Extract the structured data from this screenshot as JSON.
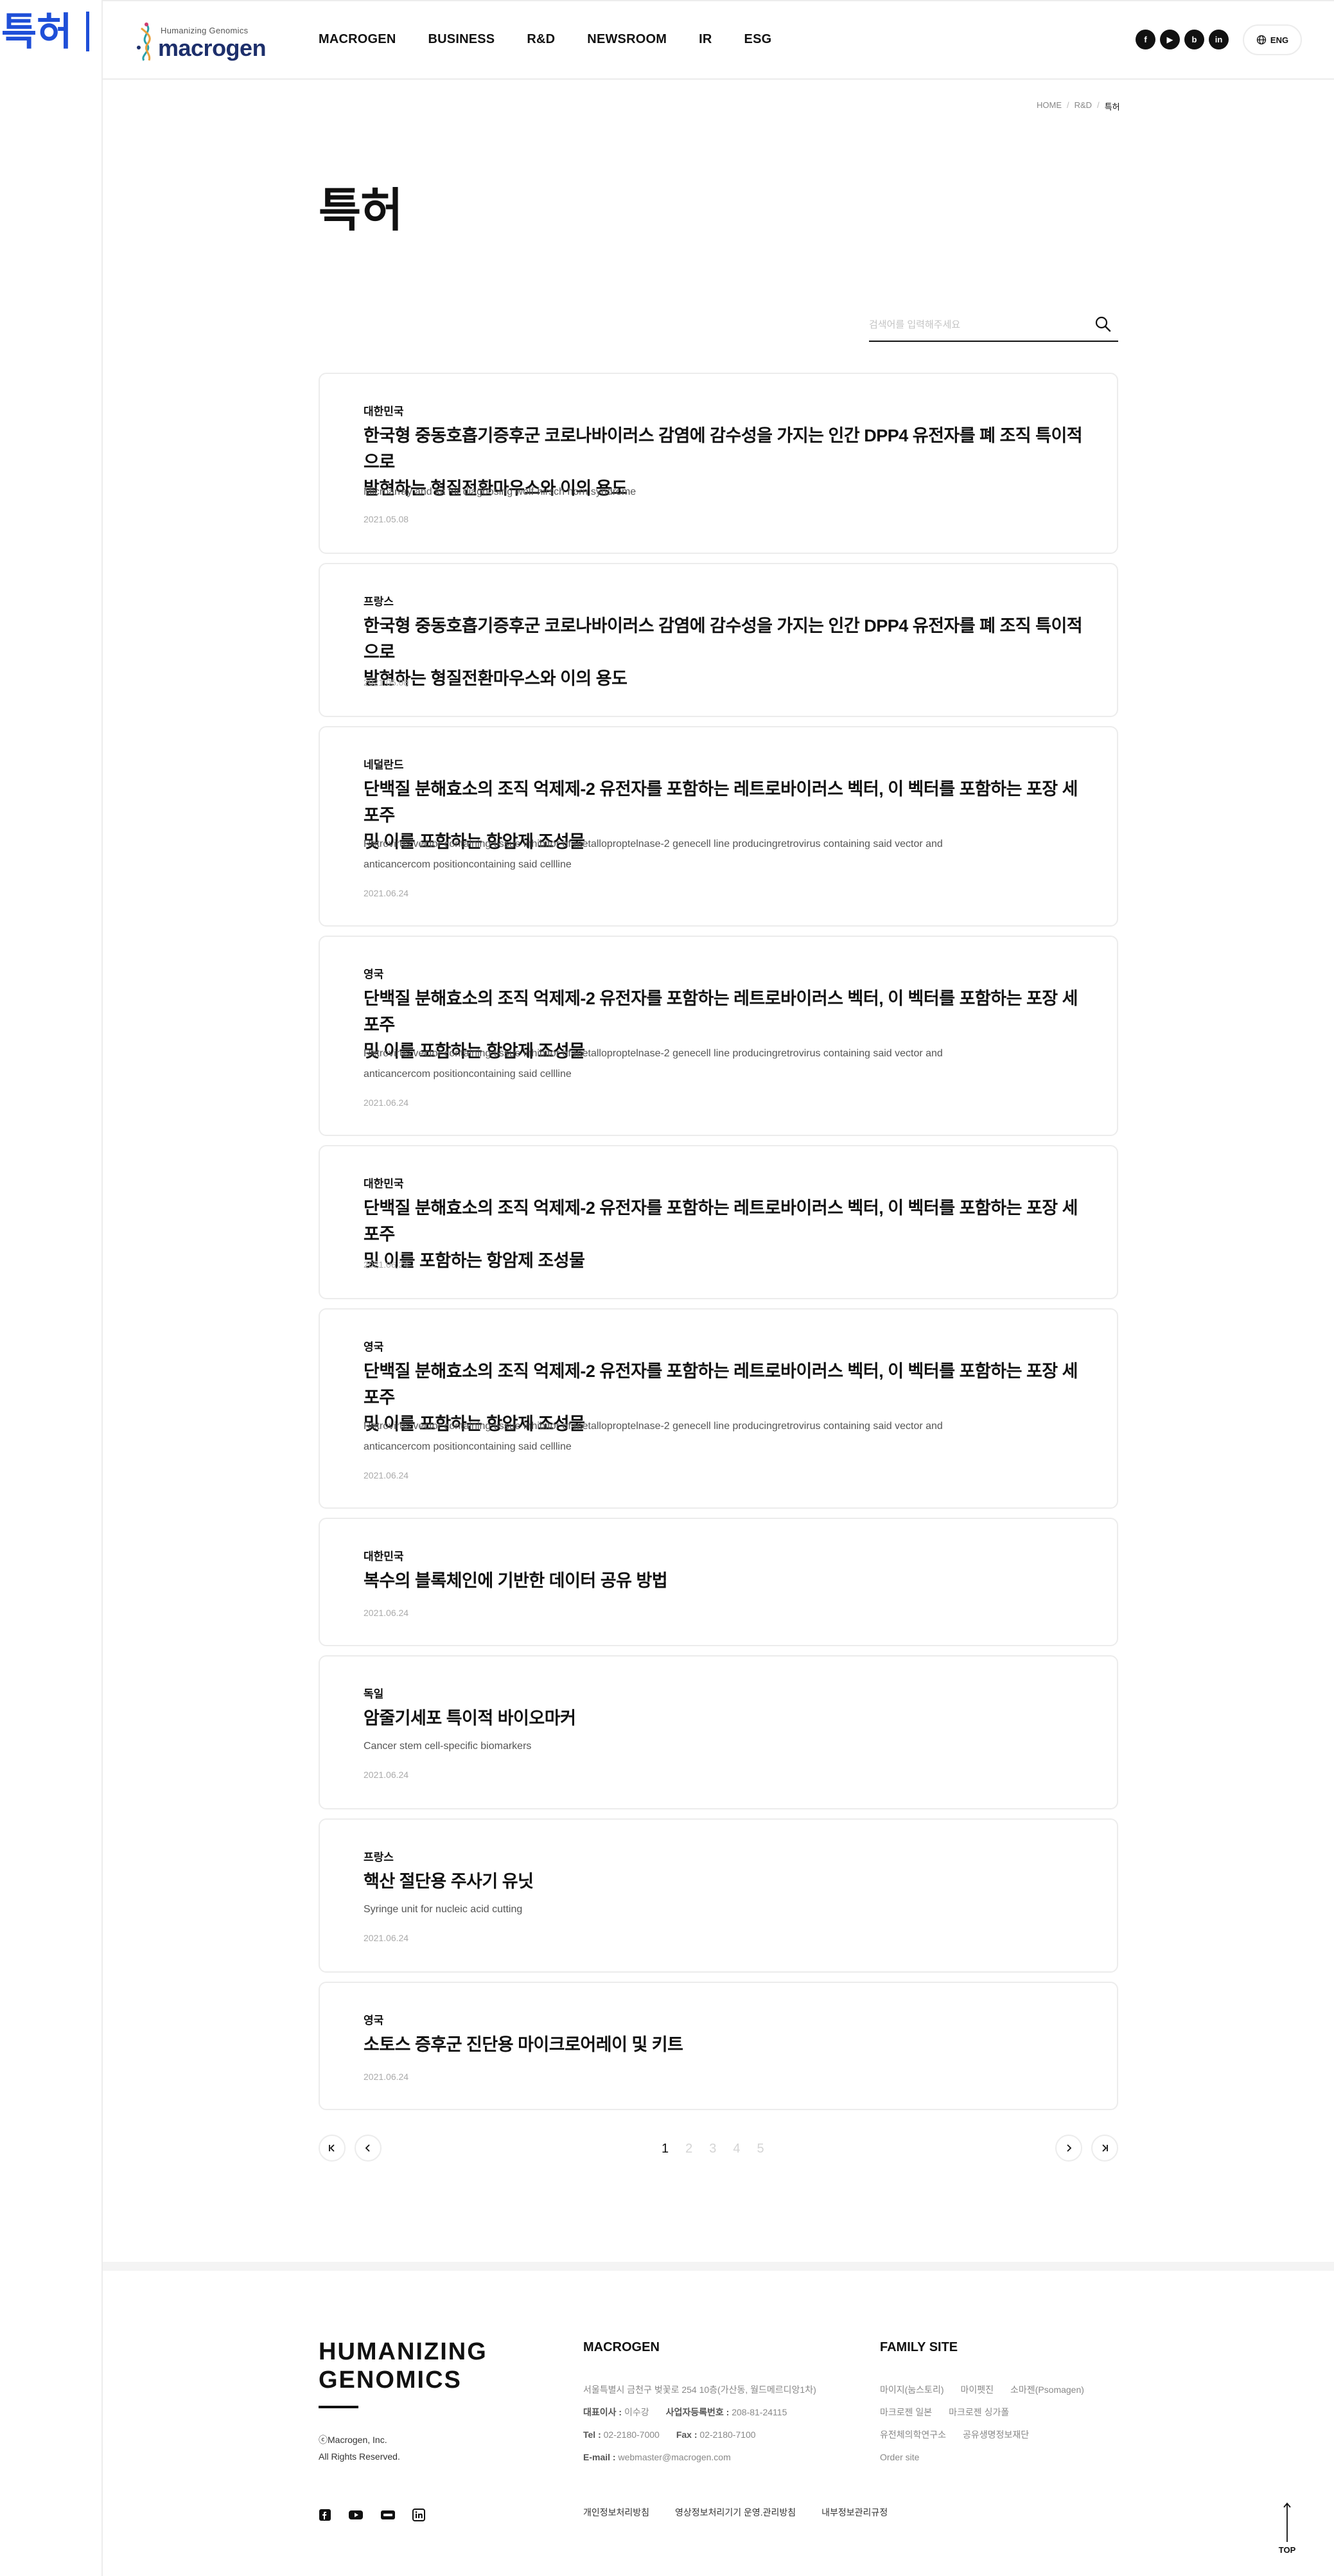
{
  "annotation": {
    "title": "특허"
  },
  "header": {
    "logo": {
      "tagline": "Humanizing Genomics",
      "wordmark": "macrogen"
    },
    "nav": [
      "MACROGEN",
      "BUSINESS",
      "R&D",
      "NEWSROOM",
      "IR",
      "ESG"
    ],
    "social": [
      "f",
      "▶",
      "b",
      "in"
    ],
    "lang": "ENG"
  },
  "breadcrumb": [
    "HOME",
    "R&D",
    "특허"
  ],
  "page_title": "특허",
  "search": {
    "placeholder": "검색어를 입력해주세요",
    "value": ""
  },
  "patents": [
    {
      "country": "대한민국",
      "title_lines": [
        "한국형 중동호흡기증후군 코로나바이러스 감염에 감수성을 가지는 인간 DPP4 유전자를 폐 조직 특이적으로",
        "발현하는 형질전환마우스와 이의 용도"
      ],
      "desc_lines": [
        "Microarray and kit for diagbosing wolf-hirsch horn syndrome"
      ],
      "date": "2021.05.08"
    },
    {
      "country": "프랑스",
      "title_lines": [
        "한국형 중동호흡기증후군 코로나바이러스 감염에 감수성을 가지는 인간 DPP4 유전자를 폐 조직 특이적으로",
        "발현하는 형질전환마우스와 이의 용도"
      ],
      "desc_lines": [],
      "date": "2021.05.08"
    },
    {
      "country": "네덜란드",
      "title_lines": [
        "단백질 분해효소의 조직 억제제-2 유전자를 포함하는 레트로바이러스 벡터, 이 벡터를 포함하는 포장 세포주",
        "및 이를 포함하는 항암제 조성물"
      ],
      "desc_lines": [
        "Retrovirus vector containing tissue inhibitor of metalloproptelnase-2 genecell line producingretrovirus containing said vector and",
        "anticancercom positioncontaining said cellline"
      ],
      "date": "2021.06.24"
    },
    {
      "country": "영국",
      "title_lines": [
        "단백질 분해효소의 조직 억제제-2 유전자를 포함하는 레트로바이러스 벡터, 이 벡터를 포함하는 포장 세포주",
        "및 이를 포함하는 항암제 조성물"
      ],
      "desc_lines": [
        "Retrovirus vector containing tissue inhibitor of metalloproptelnase-2 genecell line producingretrovirus containing said vector and",
        "anticancercom positioncontaining said cellline"
      ],
      "date": "2021.06.24"
    },
    {
      "country": "대한민국",
      "title_lines": [
        "단백질 분해효소의 조직 억제제-2 유전자를 포함하는 레트로바이러스 벡터, 이 벡터를 포함하는 포장 세포주",
        "및 이를 포함하는 항암제 조성물"
      ],
      "desc_lines": [],
      "date": "2021.06.24"
    },
    {
      "country": "영국",
      "title_lines": [
        "단백질 분해효소의 조직 억제제-2 유전자를 포함하는 레트로바이러스 벡터, 이 벡터를 포함하는 포장 세포주",
        "및 이를 포함하는 항암제 조성물"
      ],
      "desc_lines": [
        "Retrovirus vector containing tissue inhibitor of metalloproptelnase-2 genecell line producingretrovirus containing said vector and",
        "anticancercom positioncontaining said cellline"
      ],
      "date": "2021.06.24"
    },
    {
      "country": "대한민국",
      "title_lines": [
        "복수의 블록체인에 기반한 데이터 공유 방법"
      ],
      "desc_lines": [],
      "date": "2021.06.24"
    },
    {
      "country": "독일",
      "title_lines": [
        "암줄기세포 특이적 바이오마커"
      ],
      "desc_lines": [
        "Cancer stem cell-specific biomarkers"
      ],
      "date": "2021.06.24"
    },
    {
      "country": "프랑스",
      "title_lines": [
        "핵산 절단용 주사기 유닛"
      ],
      "desc_lines": [
        "Syringe unit for nucleic acid cutting"
      ],
      "date": "2021.06.24"
    },
    {
      "country": "영국",
      "title_lines": [
        "소토스 증후군 진단용 마이크로어레이 및 키트"
      ],
      "desc_lines": [],
      "date": "2021.06.24"
    }
  ],
  "pagination": {
    "pages": [
      "1",
      "2",
      "3",
      "4",
      "5"
    ],
    "current": "1"
  },
  "footer": {
    "slogan_lines": [
      "HUMANIZING",
      "GENOMICS"
    ],
    "copyright_lines": [
      "ⓒMacrogen, Inc.",
      "All Rights Reserved."
    ],
    "company_heading": "MACROGEN",
    "address": "서울특별시 금천구 벚꽃로 254 10층(가산동, 월드메르디앙1차)",
    "ceo_label": "대표이사 :",
    "ceo": "이수강",
    "bizno_label": "사업자등록번호 :",
    "bizno": "208-81-24115",
    "tel_label": "Tel :",
    "tel": "02-2180-7000",
    "fax_label": "Fax :",
    "fax": "02-2180-7100",
    "email_label": "E-mail :",
    "email": "webmaster@macrogen.com",
    "family_heading": "FAMILY SITE",
    "family_rows": [
      [
        "마이지(눔스토리)",
        "마이펫진",
        "소마젠(Psomagen)"
      ],
      [
        "마크로젠 일본",
        "마크로젠 싱가폴"
      ],
      [
        "유전체의학연구소",
        "공유생명정보재단"
      ],
      [
        "Order site"
      ]
    ],
    "social": [
      "facebook",
      "youtube",
      "blog",
      "linkedin"
    ],
    "links": [
      "개인정보처리방침",
      "영상정보처리기기 운영.관리방침",
      "내부정보관리규정"
    ],
    "top_label": "TOP"
  }
}
